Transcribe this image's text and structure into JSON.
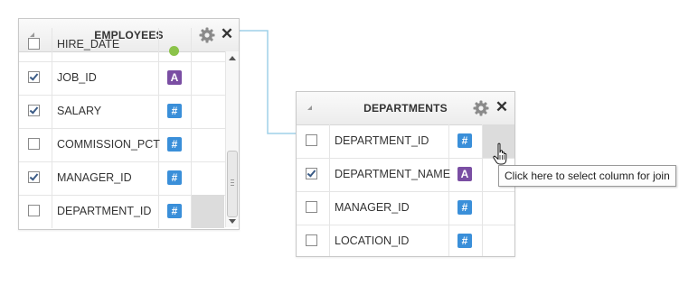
{
  "employees": {
    "title": "EMPLOYEES",
    "partial_row_name": "HIRE_DATE",
    "partial_row_type_color": "#8bc34a",
    "columns": [
      {
        "name": "JOB_ID",
        "checked": true,
        "type": "string",
        "type_glyph": "A"
      },
      {
        "name": "SALARY",
        "checked": true,
        "type": "number",
        "type_glyph": "#"
      },
      {
        "name": "COMMISSION_PCT",
        "checked": false,
        "type": "number",
        "type_glyph": "#"
      },
      {
        "name": "MANAGER_ID",
        "checked": true,
        "type": "number",
        "type_glyph": "#"
      },
      {
        "name": "DEPARTMENT_ID",
        "checked": false,
        "type": "number",
        "type_glyph": "#"
      }
    ]
  },
  "departments": {
    "title": "DEPARTMENTS",
    "columns": [
      {
        "name": "DEPARTMENT_ID",
        "checked": false,
        "type": "number",
        "type_glyph": "#"
      },
      {
        "name": "DEPARTMENT_NAME",
        "checked": true,
        "type": "string",
        "type_glyph": "A"
      },
      {
        "name": "MANAGER_ID",
        "checked": false,
        "type": "number",
        "type_glyph": "#"
      },
      {
        "name": "LOCATION_ID",
        "checked": false,
        "type": "number",
        "type_glyph": "#"
      }
    ]
  },
  "tooltip": {
    "text": "Click here to select column for join"
  },
  "icons": {
    "settings": "gear-icon",
    "close": "close-icon",
    "cursor": "hand-pointer-icon",
    "collapse": "collapse-triangle-icon"
  },
  "colors": {
    "number_type": "#3a8fd9",
    "string_type": "#7a4ea3",
    "connector": "#9fd0e8",
    "join_slot": "#dcdcdc"
  },
  "close_glyph": "✕"
}
